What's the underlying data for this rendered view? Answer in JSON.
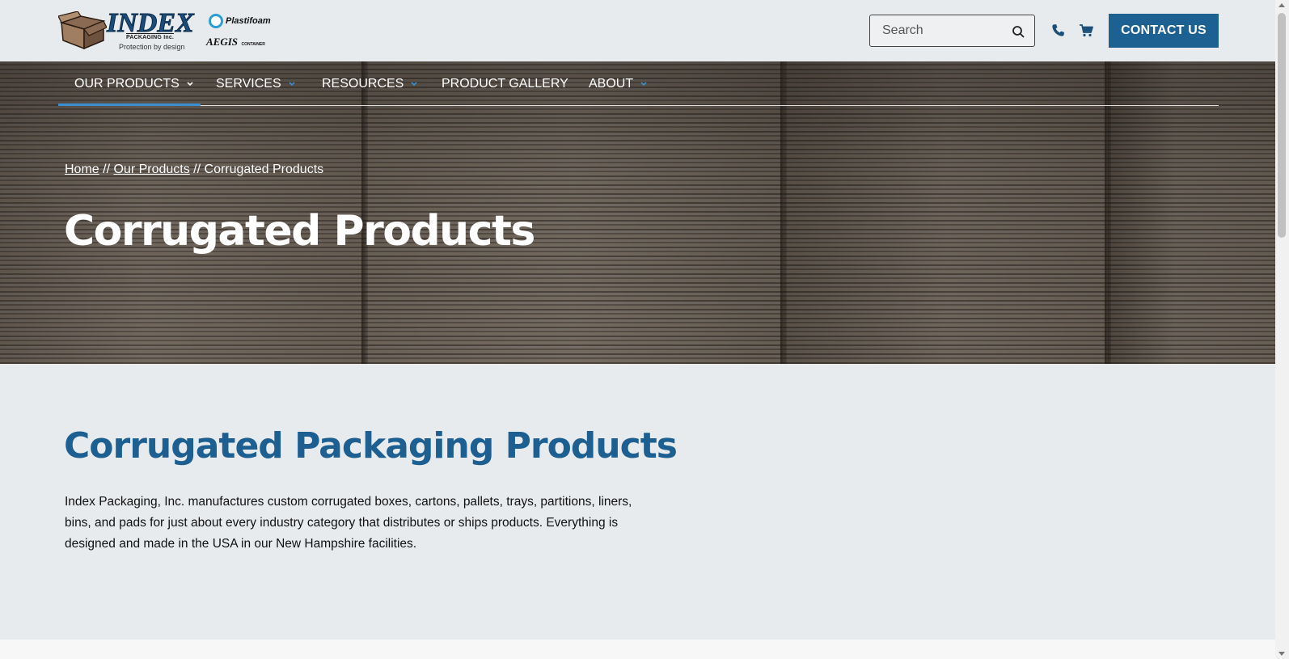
{
  "header": {
    "logo": {
      "brand": "INDEX",
      "subbrand": "PACKAGING Inc.",
      "tagline": "Protection by design"
    },
    "partner_logos": {
      "plastifoam": "Plastifoam",
      "aegis": "AEGIS",
      "aegis_sub": "CONTAINER"
    },
    "search": {
      "placeholder": "Search",
      "value": ""
    },
    "contact_label": "CONTACT US"
  },
  "nav": {
    "items": [
      {
        "label": "OUR PRODUCTS",
        "has_dropdown": true,
        "active": true
      },
      {
        "label": "SERVICES",
        "has_dropdown": true
      },
      {
        "label": "RESOURCES",
        "has_dropdown": true
      },
      {
        "label": "PRODUCT GALLERY",
        "has_dropdown": false
      },
      {
        "label": "ABOUT",
        "has_dropdown": true
      }
    ]
  },
  "breadcrumb": {
    "home": "Home",
    "sep1": " // ",
    "products": "Our Products",
    "sep2": " // ",
    "current": "Corrugated Products"
  },
  "hero": {
    "title": "Corrugated Products"
  },
  "section": {
    "title": "Corrugated Packaging Products",
    "body": "Index Packaging, Inc. manufactures custom corrugated boxes, cartons, pallets, trays, partitions, liners, bins, and pads for just about every industry category that distributes or ships products. Everything is designed and made in the USA in our New Hampshire facilities."
  },
  "colors": {
    "accent": "#1c6191",
    "heading": "#1c5f90",
    "nav_active": "#3b8fd0",
    "background": "#e8ebee"
  }
}
